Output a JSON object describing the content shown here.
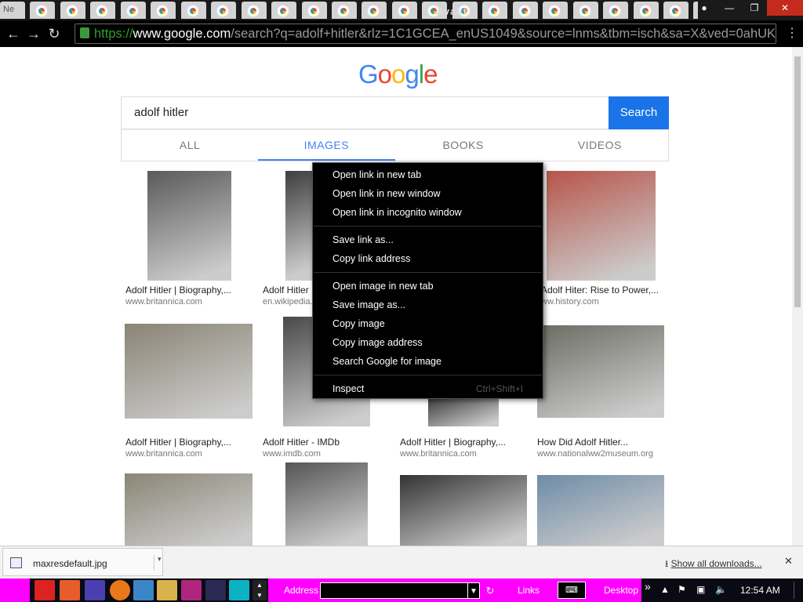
{
  "browser": {
    "tabs_first_label": "Ne",
    "avast_label": "Avast",
    "url_scheme": "https://",
    "url_host": "www.google.com",
    "url_rest": "/search?q=adolf+hitler&rlz=1C1GCEA_enUS1049&source=lnms&tbm=isch&sa=X&ved=0ahUK",
    "back_icon": "←",
    "forward_icon": "→",
    "reload_icon": "↻",
    "menu_icon": "⋮",
    "active_tab_close": "✕"
  },
  "google": {
    "logo_letters": [
      "G",
      "o",
      "o",
      "g",
      "l",
      "e"
    ],
    "logo_colors": [
      "#4285f4",
      "#ea4335",
      "#fbbc05",
      "#4285f4",
      "#34a853",
      "#ea4335"
    ],
    "query": "adolf hitler",
    "search_button": "Search",
    "tabs": [
      {
        "label": "ALL",
        "selected": false
      },
      {
        "label": "IMAGES",
        "selected": true
      },
      {
        "label": "BOOKS",
        "selected": false
      },
      {
        "label": "VIDEOS",
        "selected": false
      }
    ]
  },
  "results": [
    {
      "title": "Adolf Hitler | Biography,...",
      "source": "www.britannica.com"
    },
    {
      "title": "Adolf Hitler",
      "source": "en.wikipedia."
    },
    {
      "title": "",
      "source": ""
    },
    {
      "title": "Adolf Hiter: Rise to Power,...",
      "source": "ww.history.com"
    },
    {
      "title": "Adolf Hitler | Biography,...",
      "source": "www.britannica.com"
    },
    {
      "title": "Adolf Hitler - IMDb",
      "source": "www.imdb.com"
    },
    {
      "title": "Adolf Hitler | Biography,...",
      "source": "www.britannica.com"
    },
    {
      "title": "How Did Adolf Hitler...",
      "source": "www.nationalww2museum.org"
    },
    {
      "title": "",
      "source": ""
    },
    {
      "title": "",
      "source": ""
    },
    {
      "title": "",
      "source": ""
    },
    {
      "title": "",
      "source": ""
    }
  ],
  "context_menu": {
    "items": [
      {
        "label": "Open link in new tab"
      },
      {
        "label": "Open link in new window"
      },
      {
        "label": "Open link in incognito window"
      },
      {
        "label": "Save link as..."
      },
      {
        "label": "Copy link address"
      },
      {
        "label": "Open image in new tab"
      },
      {
        "label": "Save image as..."
      },
      {
        "label": "Copy image"
      },
      {
        "label": "Copy image address"
      },
      {
        "label": "Search Google for image"
      },
      {
        "label": "Inspect",
        "shortcut": "Ctrl+Shift+I"
      }
    ]
  },
  "downloads": {
    "file_name": "maxresdefault.jpg",
    "show_all": "Show all downloads...",
    "close": "✕",
    "download_icon": "⭳"
  },
  "taskbar": {
    "address_label": "Address",
    "links_label": "Links",
    "desktop_label": "Desktop",
    "clock": "12:54 AM",
    "chevron": "»"
  }
}
